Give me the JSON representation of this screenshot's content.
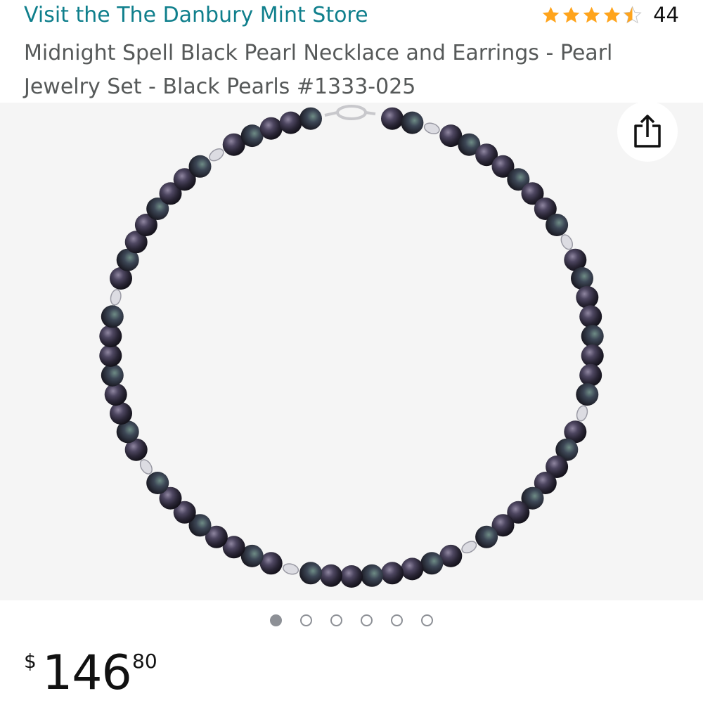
{
  "header": {
    "store_link": "Visit the The Danbury Mint Store",
    "rating_value": 4.5,
    "rating_count": "44"
  },
  "product": {
    "title": "Midnight Spell Black Pearl Necklace and Earrings - Pearl Jewelry Set - Black Pearls #1333-025"
  },
  "gallery": {
    "image_count": 6,
    "active_index": 0,
    "share_icon": "share-icon"
  },
  "price": {
    "symbol": "$",
    "whole": "146",
    "fraction": "80"
  },
  "colors": {
    "store_link": "#0f7f8c",
    "star": "#ffa41c",
    "title": "#565959"
  }
}
